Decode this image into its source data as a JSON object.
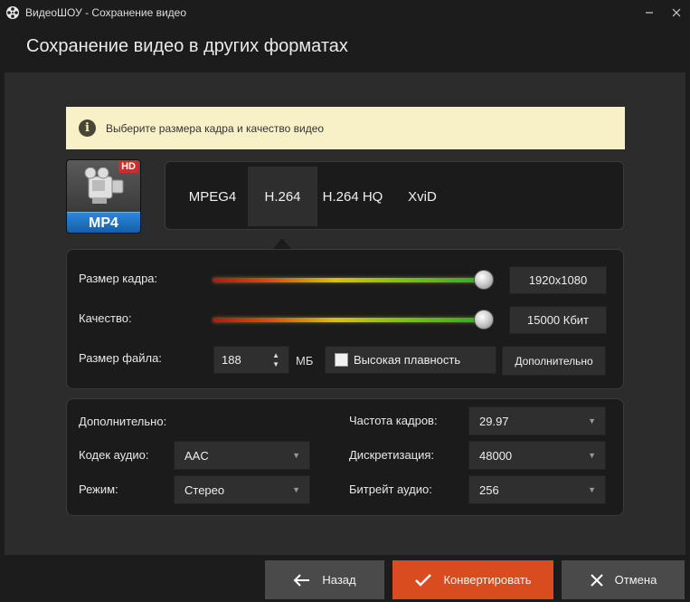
{
  "window": {
    "title": "ВидеоШОУ - Сохранение видео",
    "close_icon": "close-icon"
  },
  "header": {
    "title": "Сохранение видео в других форматах"
  },
  "info": {
    "text": "Выберите размера кадра и качество видео"
  },
  "format_badge": {
    "hd": "HD",
    "label": "MP4"
  },
  "codecs": {
    "tabs": [
      {
        "label": "MPEG4",
        "active": false
      },
      {
        "label": "H.264",
        "active": true
      },
      {
        "label": "H.264 HQ",
        "active": false
      },
      {
        "label": "XviD",
        "active": false
      }
    ]
  },
  "main": {
    "frame_size_label": "Размер кадра:",
    "frame_size_value": "1920x1080",
    "frame_size_slider": 1.0,
    "quality_label": "Качество:",
    "quality_value": "15000 Кбит",
    "quality_slider": 1.0,
    "file_size_label": "Размер файла:",
    "file_size_value": "188",
    "file_size_unit": "МБ",
    "smooth_label": "Высокая плавность",
    "smooth_checked": false,
    "advanced_button": "Дополнительно"
  },
  "extra": {
    "title": "Дополнительно:",
    "audio_codec_label": "Кодек аудио:",
    "audio_codec_value": "AAC",
    "mode_label": "Режим:",
    "mode_value": "Стерео",
    "fps_label": "Частота кадров:",
    "fps_value": "29.97",
    "sampling_label": "Дискретизация:",
    "sampling_value": "48000",
    "bitrate_label": "Битрейт аудио:",
    "bitrate_value": "256"
  },
  "footer": {
    "back": "Назад",
    "convert": "Конвертировать",
    "cancel": "Отмена"
  },
  "colors": {
    "accent": "#d94c20",
    "info_bg": "#f8f1c8"
  }
}
